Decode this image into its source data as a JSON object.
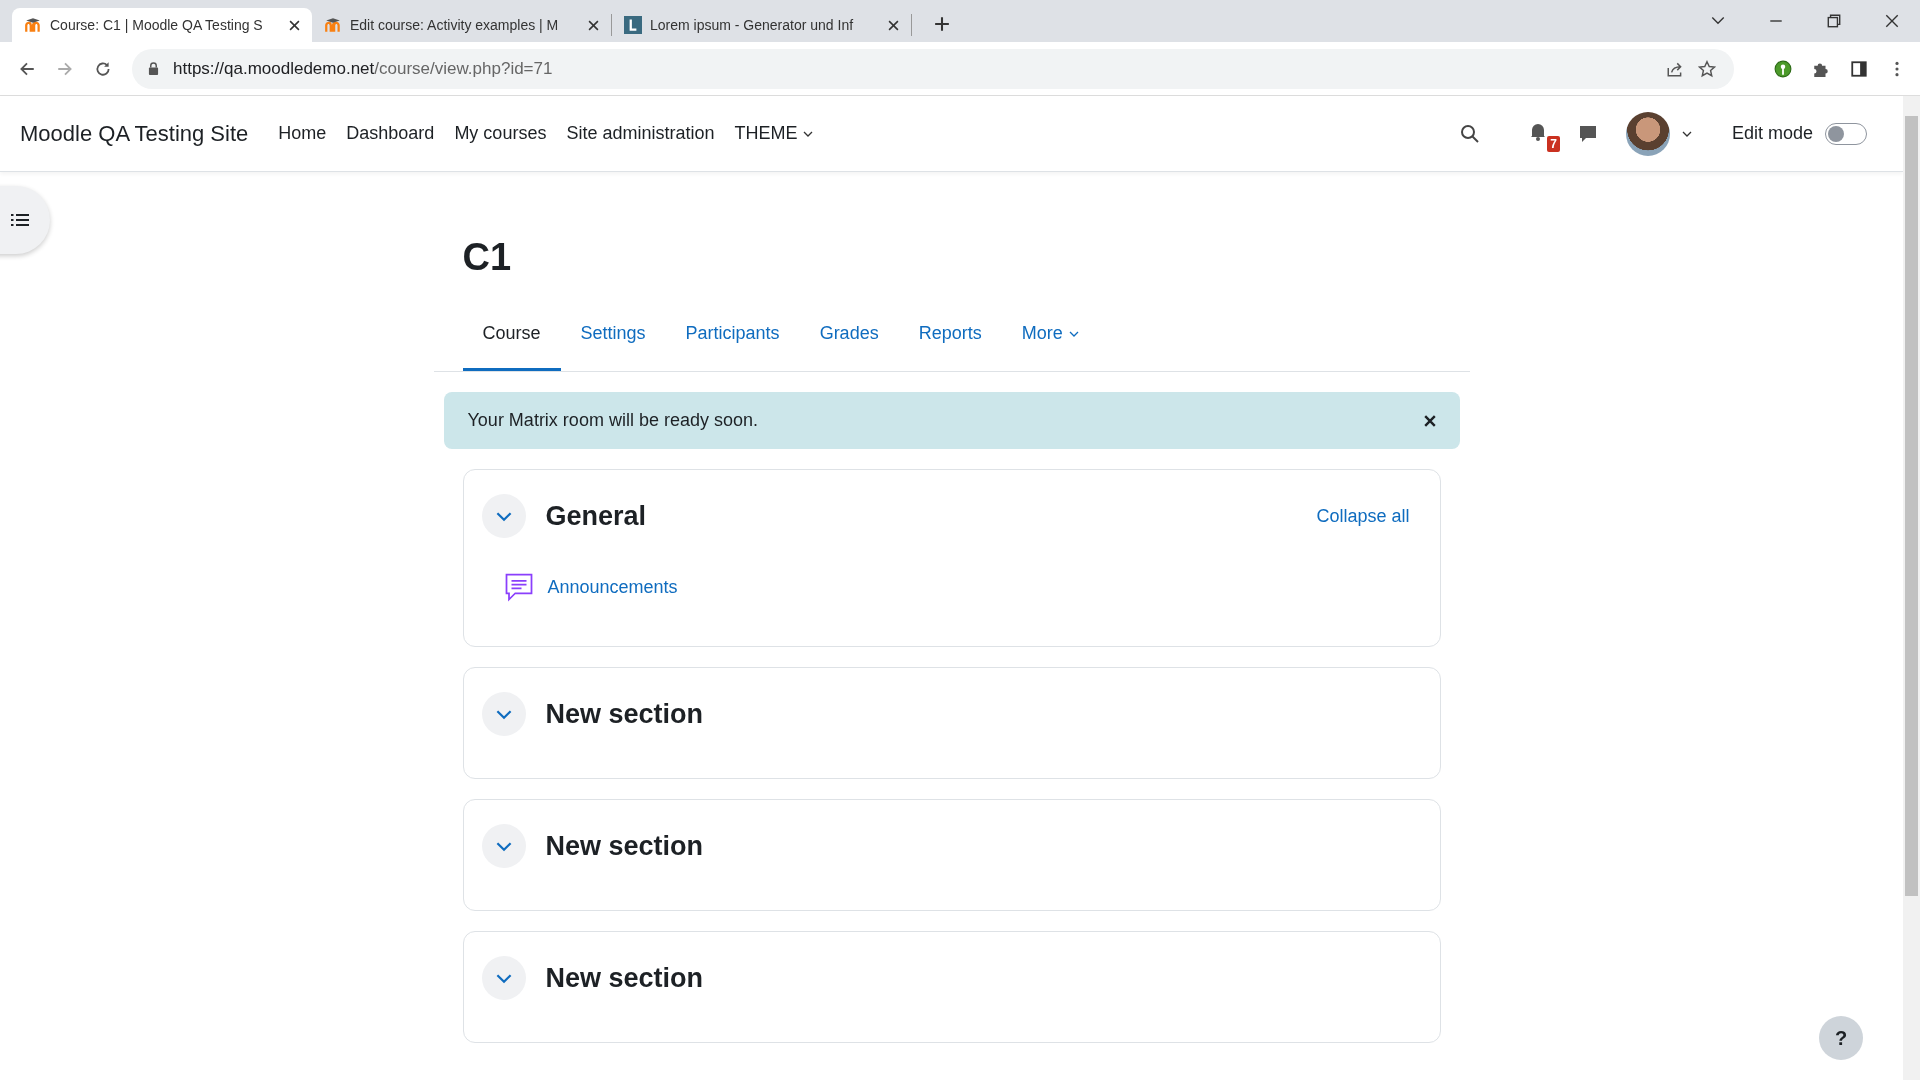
{
  "browser": {
    "tabs": [
      {
        "title": "Course: C1 | Moodle QA Testing S",
        "selected": true
      },
      {
        "title": "Edit course: Activity examples | M",
        "selected": false
      },
      {
        "title": "Lorem ipsum - Generator und Inf",
        "selected": false
      }
    ],
    "url_host": "https://qa.moodledemo.net",
    "url_path": "/course/view.php?id=71"
  },
  "navbar": {
    "site_name": "Moodle QA Testing Site",
    "links": [
      {
        "label": "Home",
        "dropdown": false
      },
      {
        "label": "Dashboard",
        "dropdown": false
      },
      {
        "label": "My courses",
        "dropdown": false
      },
      {
        "label": "Site administration",
        "dropdown": false
      },
      {
        "label": "THEME",
        "dropdown": true
      }
    ],
    "notification_count": "7",
    "edit_mode": {
      "label": "Edit mode",
      "on": false
    }
  },
  "course": {
    "title": "C1",
    "tabs": [
      {
        "label": "Course",
        "selected": true
      },
      {
        "label": "Settings",
        "selected": false
      },
      {
        "label": "Participants",
        "selected": false
      },
      {
        "label": "Grades",
        "selected": false
      },
      {
        "label": "Reports",
        "selected": false
      },
      {
        "label": "More",
        "selected": false
      }
    ],
    "alert": "Your Matrix room will be ready soon.",
    "collapse_all": "Collapse all",
    "sections": [
      {
        "title": "General",
        "expanded": true,
        "activities": [
          {
            "name": "Announcements"
          }
        ]
      },
      {
        "title": "New section",
        "expanded": true
      },
      {
        "title": "New section",
        "expanded": true
      },
      {
        "title": "New section",
        "expanded": true
      }
    ]
  },
  "help_button": "?"
}
